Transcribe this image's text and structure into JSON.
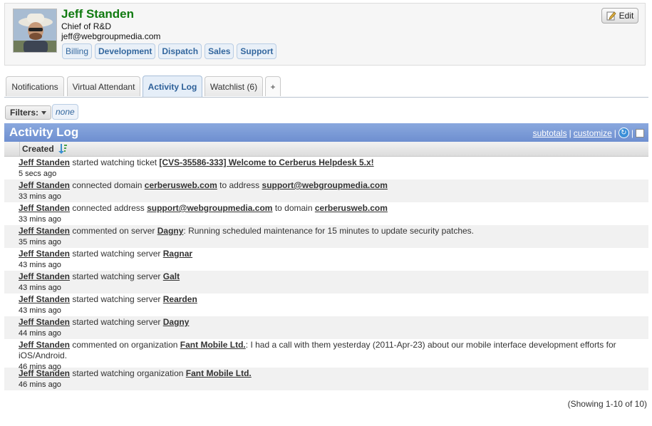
{
  "profile": {
    "name": "Jeff Standen",
    "title": "Chief of R&D",
    "email": "jeff@webgroupmedia.com",
    "groups": [
      "Billing",
      "Development",
      "Dispatch",
      "Sales",
      "Support"
    ],
    "edit_label": "Edit"
  },
  "tabs": [
    {
      "label": "Notifications"
    },
    {
      "label": "Virtual Attendant"
    },
    {
      "label": "Activity Log",
      "active": true
    },
    {
      "label": "Watchlist (6)"
    },
    {
      "label": "+"
    }
  ],
  "filters": {
    "label": "Filters:",
    "value": "none"
  },
  "activity": {
    "title": "Activity Log",
    "subtotals": "subtotals",
    "customize": "customize",
    "sep": "|",
    "column": "Created",
    "rows": [
      {
        "actor": "Jeff Standen",
        "parts": [
          " started watching ticket ",
          {
            "link": "[CVS-35586-333] Welcome to Cerberus Helpdesk 5.x!"
          }
        ],
        "time": "5 secs ago"
      },
      {
        "actor": "Jeff Standen",
        "parts": [
          " connected domain ",
          {
            "link": "cerberusweb.com"
          },
          " to address ",
          {
            "link": "support@webgroupmedia.com"
          }
        ],
        "time": "33 mins ago"
      },
      {
        "actor": "Jeff Standen",
        "parts": [
          " connected address ",
          {
            "link": "support@webgroupmedia.com"
          },
          " to domain ",
          {
            "link": "cerberusweb.com"
          }
        ],
        "time": "33 mins ago"
      },
      {
        "actor": "Jeff Standen",
        "parts": [
          " commented on server ",
          {
            "link": "Dagny"
          },
          ": Running scheduled maintenance for 15 minutes to update security patches."
        ],
        "time": "35 mins ago"
      },
      {
        "actor": "Jeff Standen",
        "parts": [
          " started watching server ",
          {
            "link": "Ragnar"
          }
        ],
        "time": "43 mins ago"
      },
      {
        "actor": "Jeff Standen",
        "parts": [
          " started watching server ",
          {
            "link": "Galt"
          }
        ],
        "time": "43 mins ago"
      },
      {
        "actor": "Jeff Standen",
        "parts": [
          " started watching server ",
          {
            "link": "Rearden"
          }
        ],
        "time": "43 mins ago"
      },
      {
        "actor": "Jeff Standen",
        "parts": [
          " started watching server ",
          {
            "link": "Dagny"
          }
        ],
        "time": "44 mins ago"
      },
      {
        "actor": "Jeff Standen",
        "parts": [
          " commented on organization ",
          {
            "link": "Fant Mobile Ltd."
          },
          ": I had a call with them yesterday (2011-Apr-23) about our mobile interface development efforts for iOS/Android."
        ],
        "time": "46 mins ago"
      },
      {
        "actor": "Jeff Standen",
        "parts": [
          " started watching organization ",
          {
            "link": "Fant Mobile Ltd."
          }
        ],
        "time": "46 mins ago"
      }
    ],
    "showing": "(Showing 1-10 of 10)"
  },
  "colors": {
    "name_green": "#107a10",
    "header_blue": "#7b9ad6",
    "link_blue": "#33679e"
  }
}
